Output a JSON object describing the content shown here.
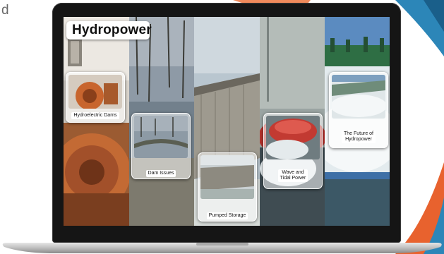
{
  "page": {
    "corner_text": "d",
    "title": "Hydropower"
  },
  "cards": [
    {
      "label": "Hydroelectric Dams"
    },
    {
      "label": "Dam Issues"
    },
    {
      "label": "Pumped Storage"
    },
    {
      "label_line1": "Wave and",
      "label_line2": "Tidal Power"
    },
    {
      "label_line1": "The Future of",
      "label_line2": "Hydropower"
    }
  ],
  "colors": {
    "accent_orange": "#e8622e",
    "accent_blue": "#2c86b8",
    "laptop_bezel": "#151515"
  },
  "icons": [
    "laptop-device-icon"
  ]
}
